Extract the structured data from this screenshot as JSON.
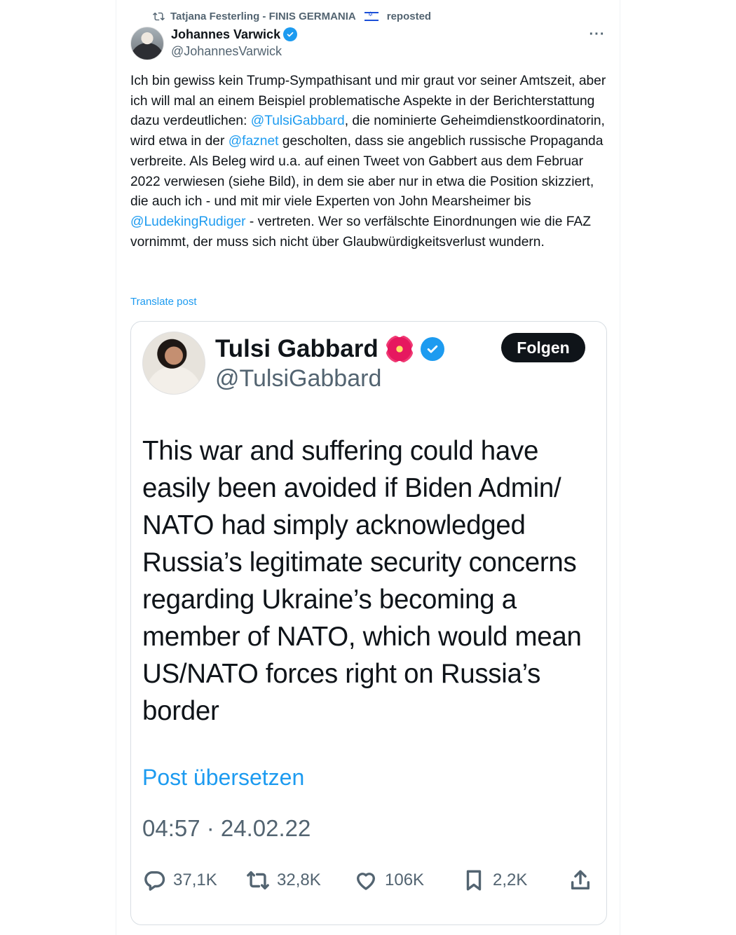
{
  "repost": {
    "icon": "repost-icon",
    "user": "Tatjana Festerling - FINIS GERMANIA",
    "suffix": "reposted"
  },
  "post": {
    "author_name": "Johannes Varwick",
    "author_handle": "@JohannesVarwick",
    "more_label": "···",
    "text_parts": {
      "p1": "Ich bin gewiss kein Trump-Sympathisant und mir graut vor seiner Amtszeit, aber ich will mal an einem Beispiel problematische Aspekte in der Berichterstattung dazu verdeutlichen: ",
      "m1": "@TulsiGabbard",
      "p2": ", die nominierte Geheimdienstkoordinatorin, wird etwa in der ",
      "m2": "@faznet",
      "p3": " gescholten, dass sie angeblich russische Propaganda verbreite. Als Beleg wird u.a. auf einen Tweet von Gabbert aus dem Februar 2022 verwiesen (siehe Bild), in dem sie aber nur in etwa die Position skizziert, die auch ich - und mit mir viele Experten von John Mearsheimer bis ",
      "m3": "@LudekingRudiger",
      "p4": " - vertreten. Wer so verfälschte Einordnungen wie die FAZ vornimmt, der muss sich nicht über Glaubwürdigkeitsverlust wundern."
    },
    "translate_label": "Translate post"
  },
  "embed": {
    "name": "Tulsi Gabbard",
    "handle": "@TulsiGabbard",
    "follow_label": "Folgen",
    "text": "This war and suffering could have easily been avoided if Biden Admin/ NATO had simply acknowledged Russia’s legitimate security concerns regarding Ukraine’s becoming a member of NATO, which would mean US/NATO forces right on Russia’s border",
    "translate_label": "Post übersetzen",
    "timestamp": "04:57 · 24.02.22",
    "replies": "37,1K",
    "reposts": "32,8K",
    "likes": "106K",
    "bookmarks": "2,2K"
  },
  "colors": {
    "accent": "#1d9bf0",
    "text": "#0f1419",
    "muted": "#536471"
  }
}
